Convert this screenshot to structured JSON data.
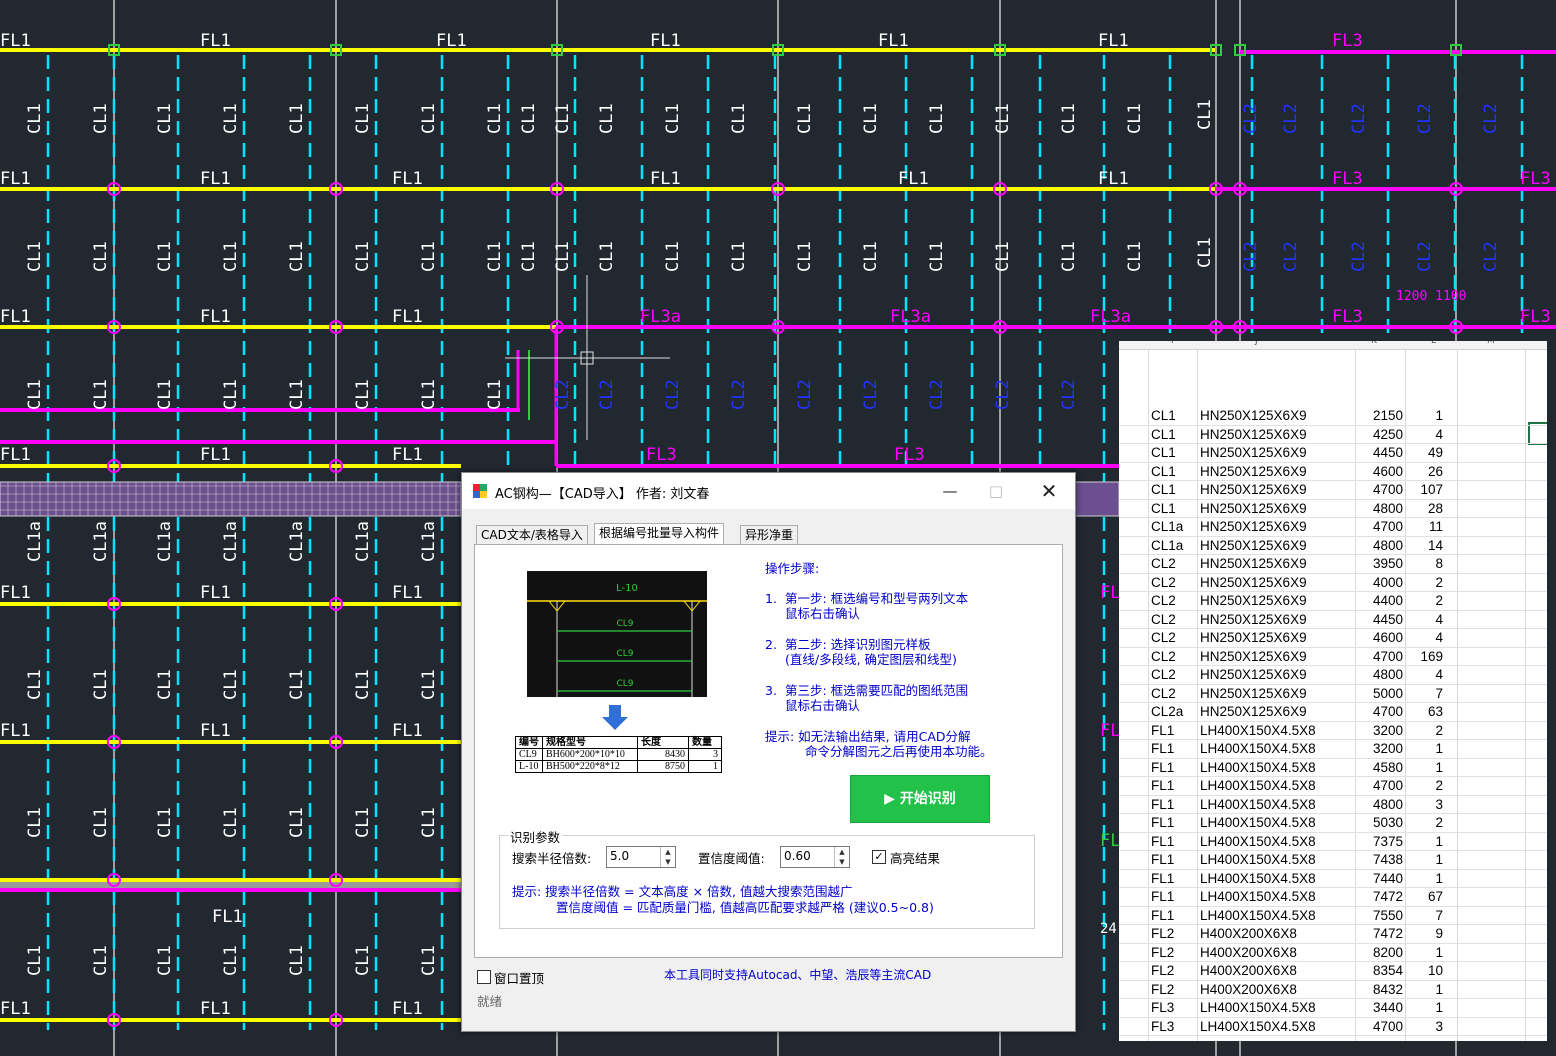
{
  "cad": {
    "labels": {
      "fl1": "FL1",
      "fl3": "FL3",
      "fl3a": "FL3a",
      "cl1": "CL1",
      "cl1a": "CL1a",
      "cl2": "CL2",
      "dim": "1200 1100",
      "n24": "24"
    }
  },
  "colors": {
    "cad_bg": "#212830",
    "beam_yellow": "#ffff00",
    "beam_magenta": "#ff00ff",
    "grid_cyan": "#00e5ff",
    "text_white": "#ffffff",
    "text_blue": "#2233ff",
    "accent_green": "#21c14a",
    "hint_blue": "#0000cc"
  },
  "dialog": {
    "title": "AC钢构—【CAD导入】 作者: 刘文春",
    "icons": {
      "minimize": "minimize-icon",
      "maximize": "maximize-icon",
      "close": "close-icon"
    },
    "tabs": [
      {
        "label": "CAD文本/表格导入"
      },
      {
        "label": "根据编号批量导入构件"
      },
      {
        "label": "异形净重"
      }
    ],
    "preview": {
      "beam_labels": [
        "L-10",
        "CL9",
        "CL9",
        "CL9"
      ],
      "table": {
        "headers": [
          "编号",
          "规格型号",
          "长度",
          "数量"
        ],
        "rows": [
          [
            "CL9",
            "BH600*200*10*10",
            "8430",
            "3"
          ],
          [
            "L-10",
            "BH500*220*8*12",
            "8750",
            "1"
          ]
        ]
      }
    },
    "steps": {
      "heading": "操作步骤:",
      "items": [
        {
          "num": "1.",
          "line1": "第一步: 框选编号和型号两列文本",
          "line2": "鼠标右击确认"
        },
        {
          "num": "2.",
          "line1": "第二步: 选择识别图元样板",
          "line2": "(直线/多段线, 确定图层和线型)"
        },
        {
          "num": "3.",
          "line1": "第三步: 框选需要匹配的图纸范围",
          "line2": "鼠标右击确认"
        }
      ],
      "tip_line1": "提示: 如无法输出结果, 请用CAD分解",
      "tip_line2": "命令分解图元之后再使用本功能。"
    },
    "start_button": "▶ 开始识别",
    "params": {
      "title": "识别参数",
      "radius_label": "搜索半径倍数:",
      "radius_value": "5.0",
      "conf_label": "置信度阈值:",
      "conf_value": "0.60",
      "highlight_label": "高亮结果",
      "highlight_checked": true,
      "tip_line1": "提示: 搜索半径倍数 = 文本高度 × 倍数, 值越大搜索范围越广",
      "tip_line2": "置信度阈值 = 匹配质量门槛, 值越高匹配要求越严格 (建议0.5~0.8)"
    },
    "pin_label": "窗口置顶",
    "pin_checked": false,
    "footer_note": "本工具同时支持Autocad、中望、浩辰等主流CAD",
    "status": "就绪"
  },
  "sheet": {
    "columns": [
      "I",
      "J",
      "K",
      "L",
      "M"
    ],
    "rows": [
      [
        "CL1",
        "HN250X125X6X9",
        "2150",
        "1"
      ],
      [
        "CL1",
        "HN250X125X6X9",
        "4250",
        "4"
      ],
      [
        "CL1",
        "HN250X125X6X9",
        "4450",
        "49"
      ],
      [
        "CL1",
        "HN250X125X6X9",
        "4600",
        "26"
      ],
      [
        "CL1",
        "HN250X125X6X9",
        "4700",
        "107"
      ],
      [
        "CL1",
        "HN250X125X6X9",
        "4800",
        "28"
      ],
      [
        "CL1a",
        "HN250X125X6X9",
        "4700",
        "11"
      ],
      [
        "CL1a",
        "HN250X125X6X9",
        "4800",
        "14"
      ],
      [
        "CL2",
        "HN250X125X6X9",
        "3950",
        "8"
      ],
      [
        "CL2",
        "HN250X125X6X9",
        "4000",
        "2"
      ],
      [
        "CL2",
        "HN250X125X6X9",
        "4400",
        "2"
      ],
      [
        "CL2",
        "HN250X125X6X9",
        "4450",
        "4"
      ],
      [
        "CL2",
        "HN250X125X6X9",
        "4600",
        "4"
      ],
      [
        "CL2",
        "HN250X125X6X9",
        "4700",
        "169"
      ],
      [
        "CL2",
        "HN250X125X6X9",
        "4800",
        "4"
      ],
      [
        "CL2",
        "HN250X125X6X9",
        "5000",
        "7"
      ],
      [
        "CL2a",
        "HN250X125X6X9",
        "4700",
        "63"
      ],
      [
        "FL1",
        "LH400X150X4.5X8",
        "3200",
        "2"
      ],
      [
        "FL1",
        "LH400X150X4.5X8",
        "3200",
        "1"
      ],
      [
        "FL1",
        "LH400X150X4.5X8",
        "4580",
        "1"
      ],
      [
        "FL1",
        "LH400X150X4.5X8",
        "4700",
        "2"
      ],
      [
        "FL1",
        "LH400X150X4.5X8",
        "4800",
        "3"
      ],
      [
        "FL1",
        "LH400X150X4.5X8",
        "5030",
        "2"
      ],
      [
        "FL1",
        "LH400X150X4.5X8",
        "7375",
        "1"
      ],
      [
        "FL1",
        "LH400X150X4.5X8",
        "7438",
        "1"
      ],
      [
        "FL1",
        "LH400X150X4.5X8",
        "7440",
        "1"
      ],
      [
        "FL1",
        "LH400X150X4.5X8",
        "7472",
        "67"
      ],
      [
        "FL1",
        "LH400X150X4.5X8",
        "7550",
        "7"
      ],
      [
        "FL2",
        "H400X200X6X8",
        "7472",
        "9"
      ],
      [
        "FL2",
        "H400X200X6X8",
        "8200",
        "1"
      ],
      [
        "FL2",
        "H400X200X6X8",
        "8354",
        "10"
      ],
      [
        "FL2",
        "H400X200X6X8",
        "8432",
        "1"
      ],
      [
        "FL3",
        "LH400X150X4.5X8",
        "3440",
        "1"
      ],
      [
        "FL3",
        "LH400X150X4.5X8",
        "4700",
        "3"
      ]
    ]
  }
}
